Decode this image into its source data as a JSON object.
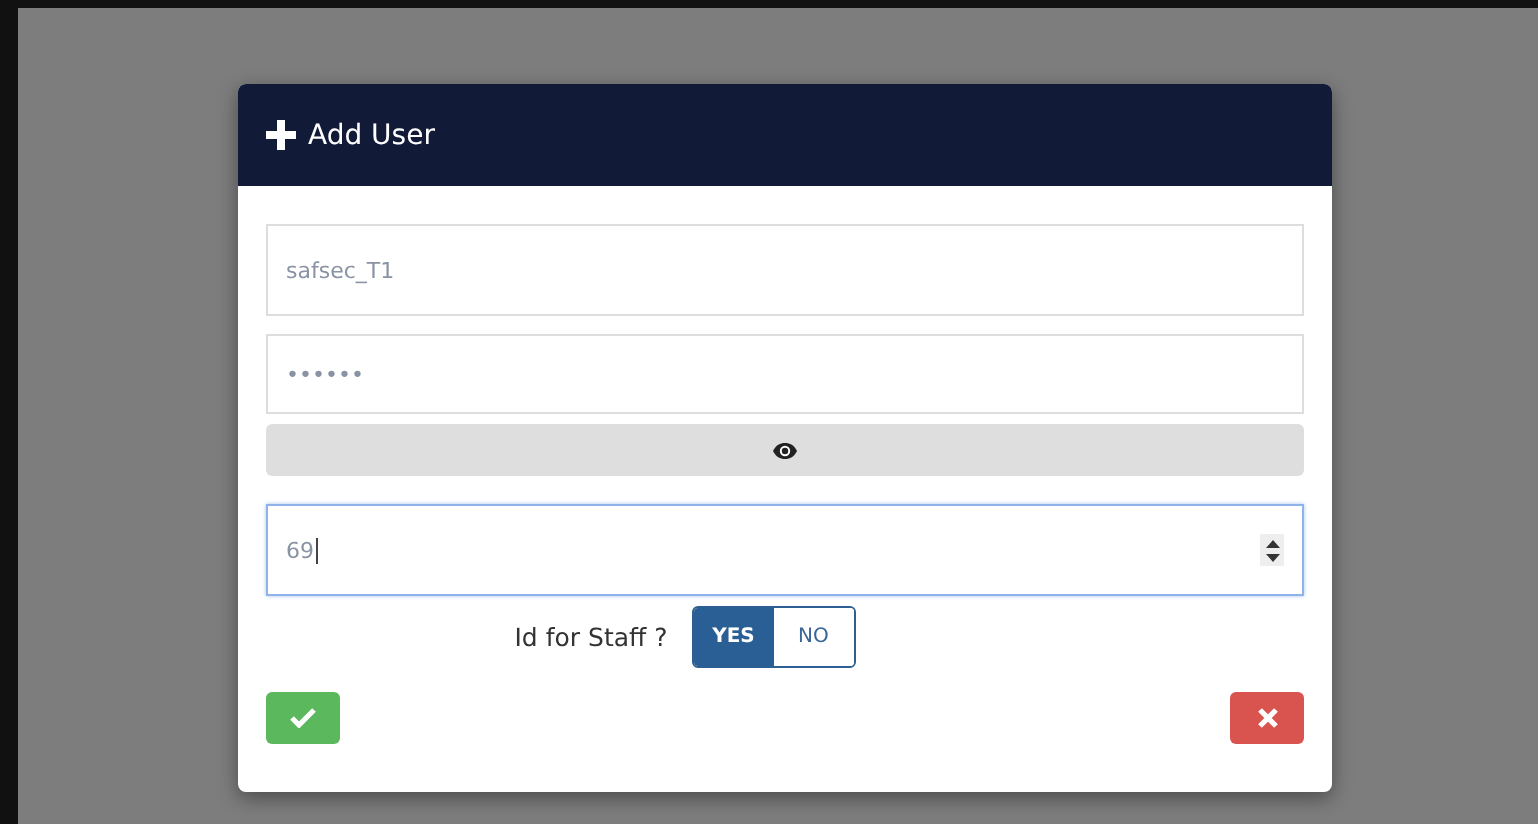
{
  "dialog": {
    "title": "Add User",
    "username": {
      "value": "safsec_T1"
    },
    "password": {
      "value": "••••••"
    },
    "number": {
      "value": "69",
      "focused": true
    },
    "staff_toggle": {
      "label": "Id for Staff ?",
      "options": [
        {
          "label": "YES",
          "selected": true
        },
        {
          "label": "NO",
          "selected": false
        }
      ]
    }
  }
}
